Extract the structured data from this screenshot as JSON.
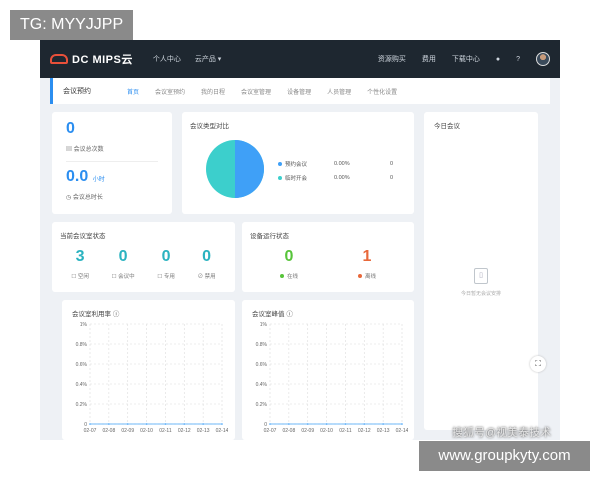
{
  "watermarks": {
    "top": "TG: MYYJJPP",
    "bottom": "www.groupkyty.com",
    "sohu": "搜狐号@视美泰技术"
  },
  "topbar": {
    "logo": "DC MIPS云",
    "nav_left": [
      "个人中心",
      "云产品 ▾"
    ],
    "nav_right": [
      "资源购买",
      "费用",
      "下载中心"
    ]
  },
  "tabbar": {
    "title": "会议预约",
    "tabs": [
      "首页",
      "会议室预约",
      "我的日程",
      "会议室管理",
      "设备管理",
      "人员管理",
      "个性化设置"
    ],
    "active_index": 0
  },
  "summary": {
    "count_value": "0",
    "count_label": "会议总次数",
    "duration_value": "0.0",
    "duration_unit": "小时",
    "duration_label": "会议总时长"
  },
  "type_compare": {
    "title": "会议类型对比",
    "rows": [
      {
        "name": "预约会议",
        "percent": "0.00%",
        "count": "0",
        "color": "#3fa0f7"
      },
      {
        "name": "临时开会",
        "percent": "0.00%",
        "count": "0",
        "color": "#3ccfcc"
      }
    ]
  },
  "today": {
    "title": "今日会议",
    "empty_text": "今日暂无会议安排"
  },
  "room_status": {
    "title": "当前会议室状态",
    "items": [
      {
        "value": "3",
        "label": "空闲",
        "icon": "idle-icon"
      },
      {
        "value": "0",
        "label": "会议中",
        "icon": "meeting-icon"
      },
      {
        "value": "0",
        "label": "专用",
        "icon": "dedicated-icon"
      },
      {
        "value": "0",
        "label": "禁用",
        "icon": "disabled-icon"
      }
    ]
  },
  "device_status": {
    "title": "设备运行状态",
    "online_value": "0",
    "online_label": "在线",
    "online_color": "#57c43a",
    "offline_value": "1",
    "offline_label": "离线",
    "offline_color": "#e8683a"
  },
  "chart_data": [
    {
      "type": "line",
      "title": "会议室利用率",
      "x": [
        "02-07",
        "02-08",
        "02-09",
        "02-10",
        "02-11",
        "02-12",
        "02-13",
        "02-14"
      ],
      "y_ticks": [
        "1%",
        "0.8%",
        "0.6%",
        "0.4%",
        "0.2%",
        "0"
      ],
      "ylim": [
        0,
        1
      ],
      "series": [
        {
          "values": [
            0,
            0,
            0,
            0,
            0,
            0,
            0,
            0
          ]
        }
      ],
      "grid": true
    },
    {
      "type": "line",
      "title": "会议室峰值",
      "x": [
        "02-07",
        "02-08",
        "02-09",
        "02-10",
        "02-11",
        "02-12",
        "02-13",
        "02-14"
      ],
      "y_ticks": [
        "1%",
        "0.8%",
        "0.6%",
        "0.4%",
        "0.2%",
        "0"
      ],
      "ylim": [
        0,
        1
      ],
      "series": [
        {
          "values": [
            0,
            0,
            0,
            0,
            0,
            0,
            0,
            0
          ]
        }
      ],
      "grid": true
    }
  ]
}
